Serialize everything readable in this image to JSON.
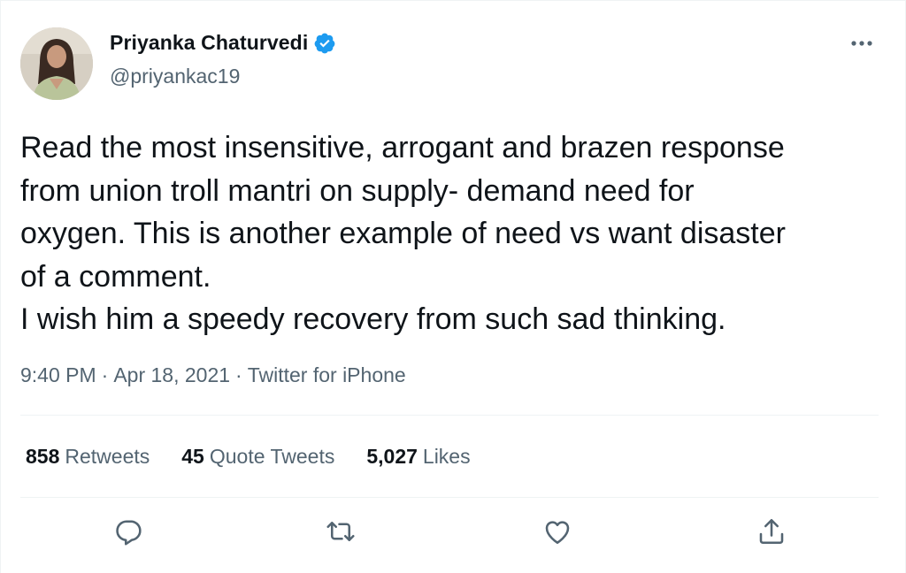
{
  "author": {
    "name": "Priyanka Chaturvedi",
    "handle": "@priyankac19",
    "verified": true
  },
  "tweet": {
    "text": "Read the most insensitive, arrogant and brazen response\nfrom union troll mantri on supply- demand need for\noxygen. This is another example of need vs want disaster\nof a comment.\nI wish him a speedy recovery from such sad thinking.",
    "time": "9:40 PM",
    "date": "Apr 18, 2021",
    "source": "Twitter for iPhone",
    "separator": "·"
  },
  "stats": {
    "retweets_count": "858",
    "retweets_label": "Retweets",
    "quotes_count": "45",
    "quotes_label": "Quote Tweets",
    "likes_count": "5,027",
    "likes_label": "Likes"
  },
  "icons": {
    "more": "more-horizontal-icon",
    "verified": "verified-badge-icon",
    "reply": "reply-icon",
    "retweet": "retweet-icon",
    "like": "heart-icon",
    "share": "share-icon"
  },
  "colors": {
    "verified": "#1d9bf0",
    "secondary_text": "#536471",
    "primary_text": "#0f1419",
    "divider": "#eff3f4"
  }
}
